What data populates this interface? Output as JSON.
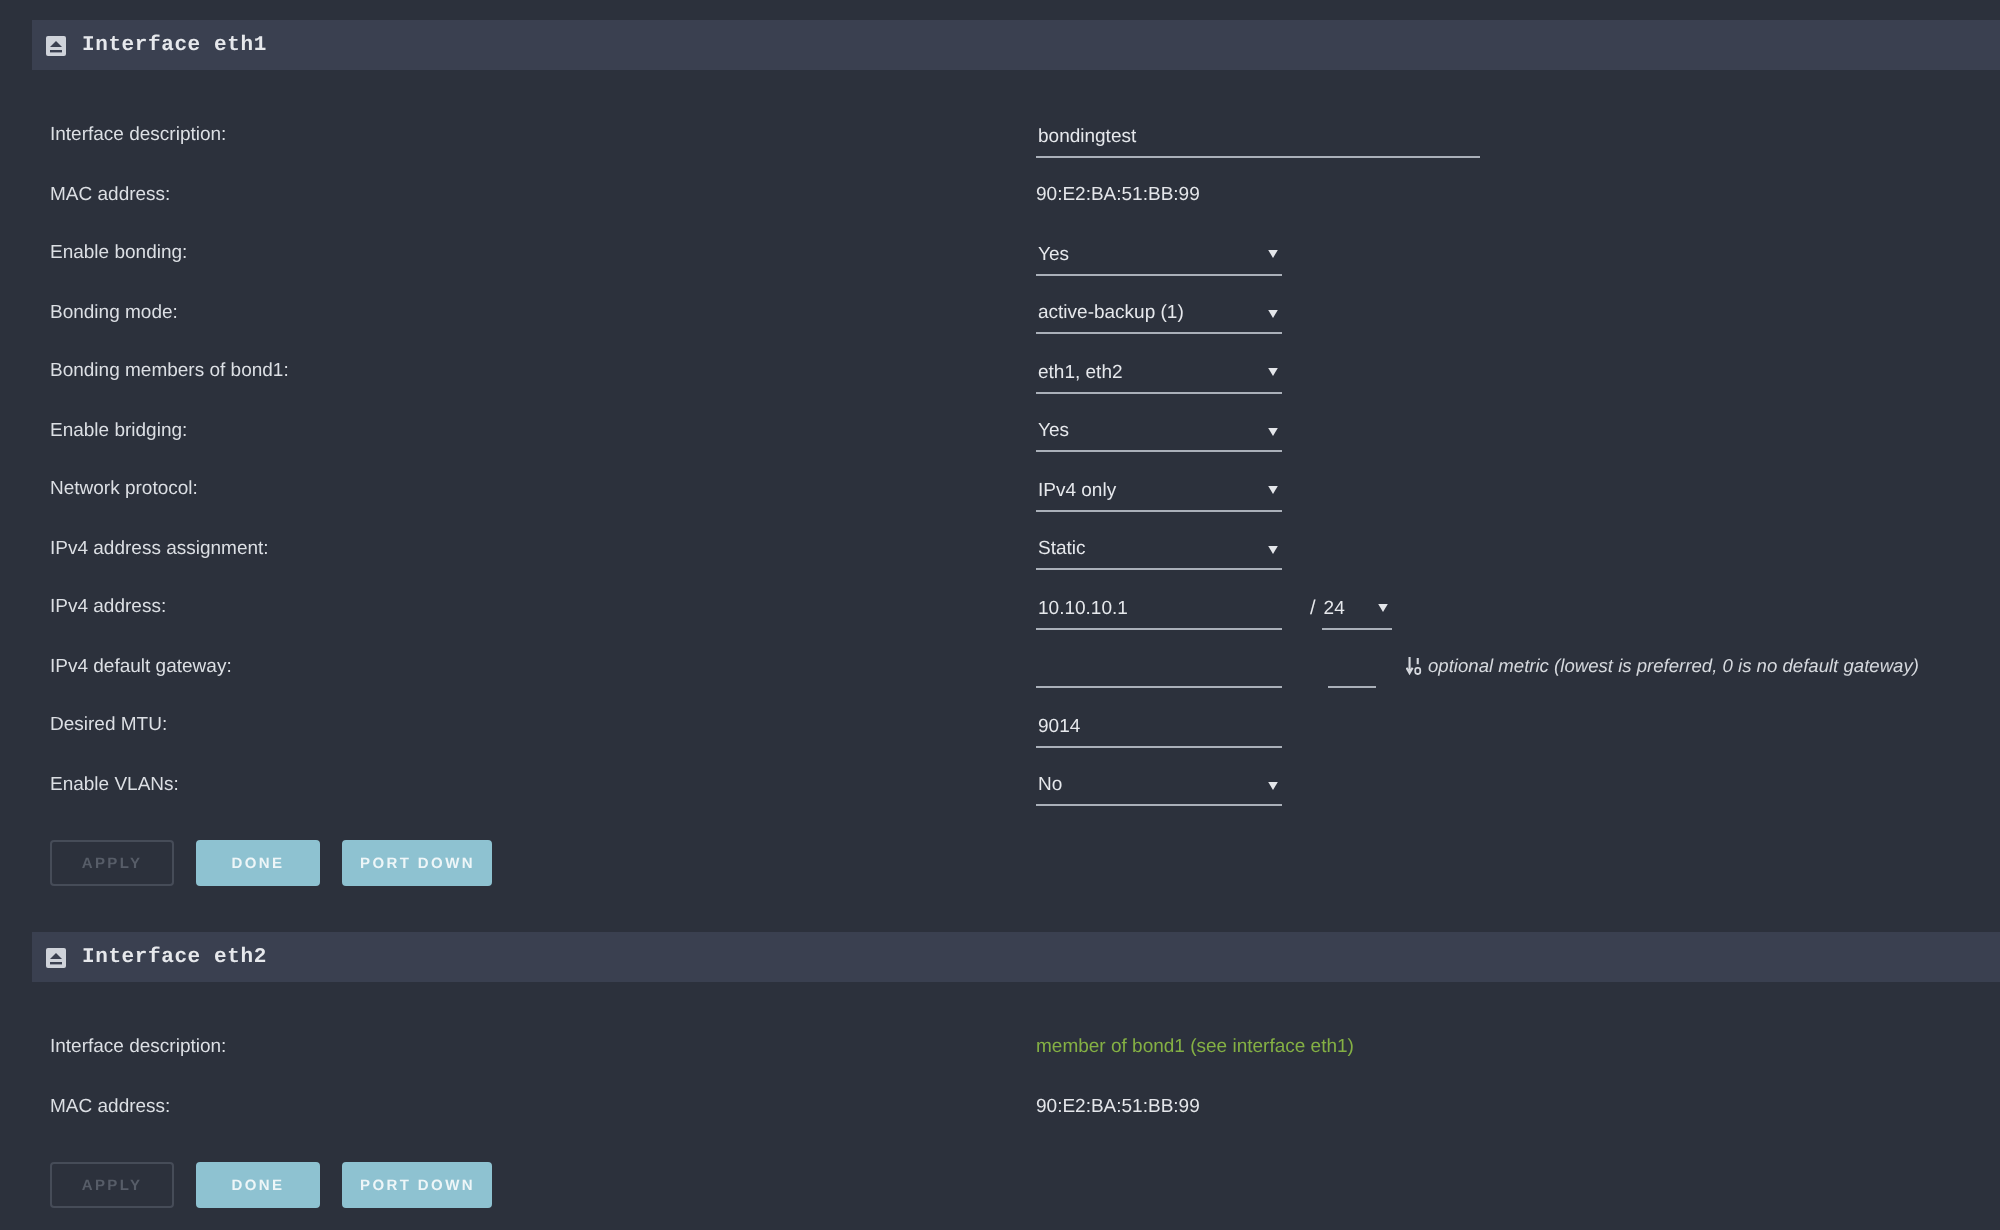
{
  "panels": [
    {
      "title": "Interface eth1",
      "rows": [
        {
          "label": "Interface description:",
          "kind": "text",
          "value": "bondingtest"
        },
        {
          "label": "MAC address:",
          "kind": "static",
          "value": "90:E2:BA:51:BB:99"
        },
        {
          "label": "Enable bonding:",
          "kind": "select",
          "value": "Yes"
        },
        {
          "label": "Bonding mode:",
          "kind": "select",
          "value": "active-backup (1)"
        },
        {
          "label": "Bonding members of bond1:",
          "kind": "select",
          "value": "eth1, eth2"
        },
        {
          "label": "Enable bridging:",
          "kind": "select",
          "value": "Yes"
        },
        {
          "label": "Network protocol:",
          "kind": "select",
          "value": "IPv4 only"
        },
        {
          "label": "IPv4 address assignment:",
          "kind": "select",
          "value": "Static"
        },
        {
          "label": "IPv4 address:",
          "kind": "address",
          "value": "10.10.10.1",
          "separator": "/",
          "prefix": "24"
        },
        {
          "label": "IPv4 default gateway:",
          "kind": "gateway",
          "hint": "optional metric (lowest is preferred, 0 is no default gateway)"
        },
        {
          "label": "Desired MTU:",
          "kind": "number",
          "value": "9014"
        },
        {
          "label": "Enable VLANs:",
          "kind": "select",
          "value": "No"
        }
      ],
      "buttons": [
        {
          "label": "APPLY",
          "disabled": true
        },
        {
          "label": "DONE",
          "disabled": false
        },
        {
          "label": "PORT DOWN",
          "disabled": false
        }
      ]
    },
    {
      "title": "Interface eth2",
      "rows": [
        {
          "label": "Interface description:",
          "kind": "note",
          "value": "member of bond1 (see interface eth1)"
        },
        {
          "label": "MAC address:",
          "kind": "static",
          "value": "90:E2:BA:51:BB:99"
        }
      ],
      "buttons": [
        {
          "label": "APPLY",
          "disabled": true
        },
        {
          "label": "DONE",
          "disabled": false
        },
        {
          "label": "PORT DOWN",
          "disabled": false
        }
      ]
    }
  ]
}
